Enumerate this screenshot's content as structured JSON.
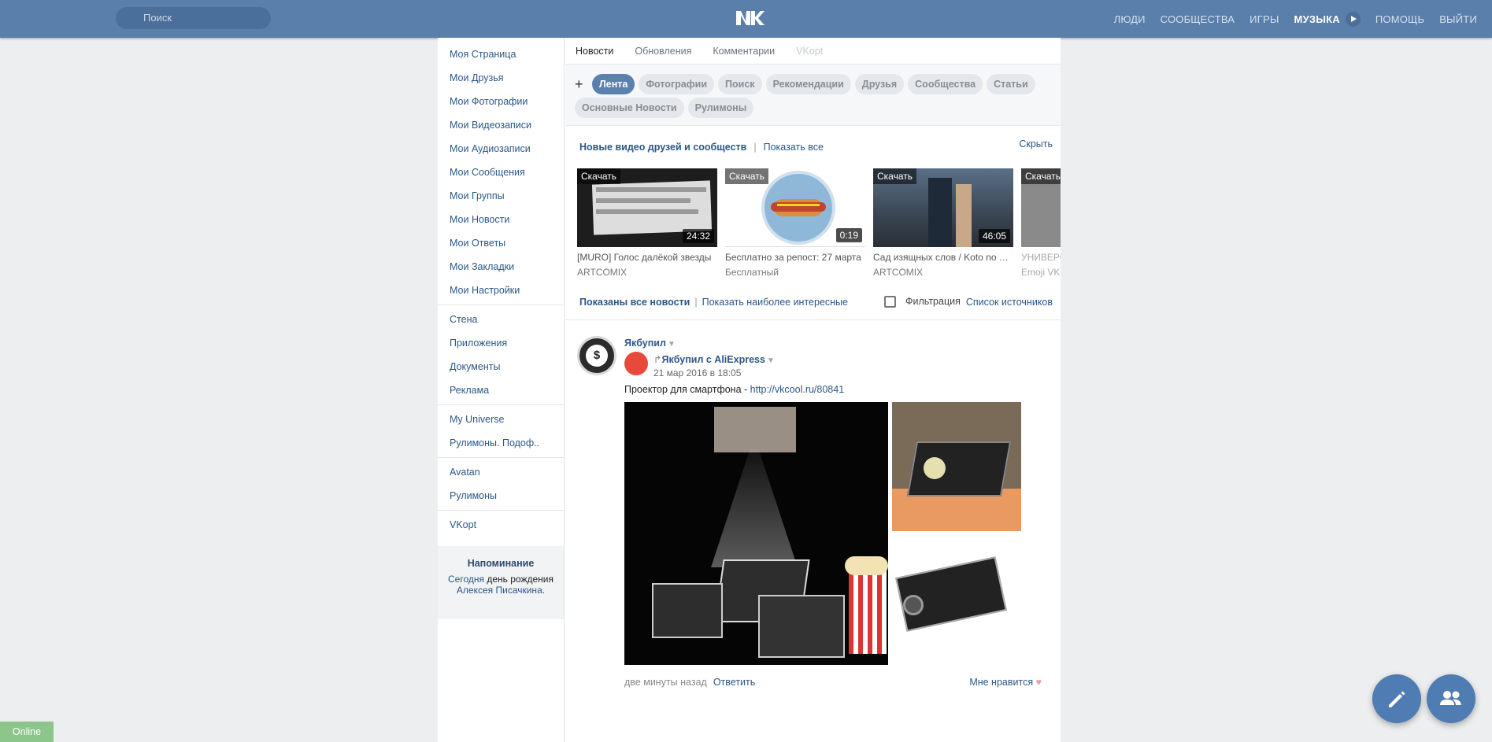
{
  "header": {
    "search_placeholder": "Поиск",
    "nav": [
      "ЛЮДИ",
      "СООБЩЕСТВА",
      "ИГРЫ",
      "МУЗЫКА",
      "ПОМОЩЬ",
      "ВЫЙТИ"
    ]
  },
  "sidebar": {
    "group1": [
      "Моя Страница",
      "Мои Друзья",
      "Мои Фотографии",
      "Мои Видеозаписи",
      "Мои Аудиозаписи",
      "Мои Сообщения",
      "Мои Группы",
      "Мои Новости",
      "Мои Ответы",
      "Мои Закладки",
      "Мои Настройки"
    ],
    "group2": [
      "Стена",
      "Приложения",
      "Документы",
      "Реклама"
    ],
    "group3": [
      "My Universe",
      "Рулимоны. Подоф.."
    ],
    "group4": [
      "Avatan",
      "Рулимоны"
    ],
    "group5": [
      "VKopt"
    ],
    "reminder": {
      "title": "Напоминание",
      "today": "Сегодня",
      "text": " день рождения",
      "person": "Алексея Писачкина."
    }
  },
  "tabs": [
    "Новости",
    "Обновления",
    "Комментарии",
    "VKopt"
  ],
  "filters": [
    "Лента",
    "Фотографии",
    "Поиск",
    "Рекомендации",
    "Друзья",
    "Сообщества",
    "Статьи",
    "Основные Новости",
    "Рулимоны"
  ],
  "videos_block": {
    "title": "Новые видео друзей и сообществ",
    "show_all": "Показать все",
    "hide": "Скрыть",
    "download": "Скачать",
    "items": [
      {
        "title": "[MURO] Голос далёкой звезды",
        "author": "ARTCOMIX",
        "duration": "24:32"
      },
      {
        "title": "Бесплатно за репост: 27 марта",
        "author": "Бесплатный",
        "duration": "0:19"
      },
      {
        "title": "Сад изящных слов / Koto no ha no niwa",
        "author": "ARTCOMIX",
        "duration": "46:05"
      },
      {
        "title": "УНИВЕРСИТЕТ",
        "author": "Emoji VK",
        "duration": ""
      }
    ]
  },
  "feed_controls": {
    "shown_all": "Показаны все новости",
    "show_interesting": "Показать наиболее интересные",
    "filter": "Фильтрация",
    "sources": "Список источников"
  },
  "post": {
    "author": "Якбупил",
    "repost_from": "Якбупил с AliExpress",
    "date": "21 мар 2016 в 18:05",
    "text": "Проектор для смартфона - ",
    "link": "http://vkcool.ru/80841",
    "time_ago": "две минуты назад",
    "reply": "Ответить",
    "like": "Мне нравится"
  },
  "status": {
    "online": "Online"
  },
  "colors": {
    "header": "#5a7fab",
    "link": "#2b5788",
    "accent": "#5b80ae"
  }
}
